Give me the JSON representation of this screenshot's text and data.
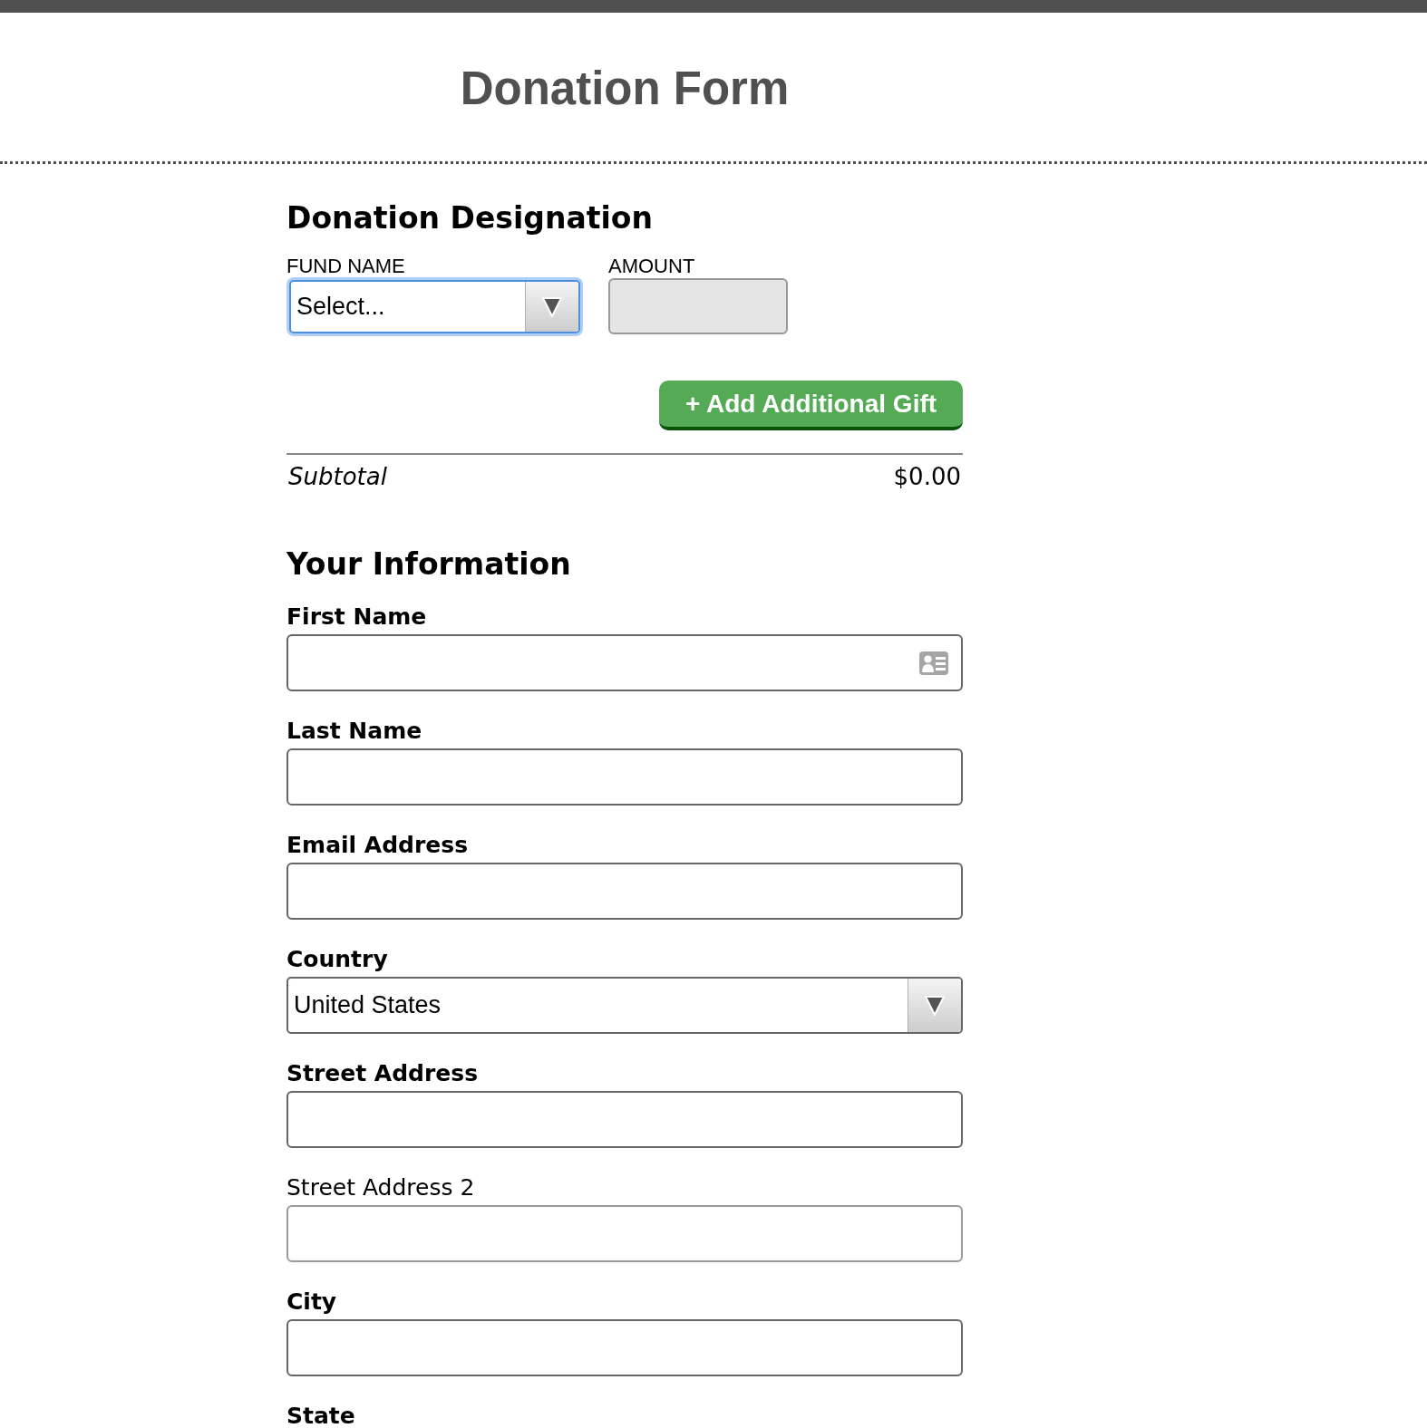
{
  "header": {
    "title": "Donation Form"
  },
  "designation": {
    "heading": "Donation Designation",
    "gift": {
      "fund_label": "FUND NAME",
      "fund_value": "Select...",
      "fund_focused": true,
      "amount_label": "AMOUNT",
      "amount_disabled": true
    },
    "add_button": "+ Add Additional Gift",
    "subtotal": {
      "label": "Subtotal",
      "value": "$0.00"
    }
  },
  "information": {
    "heading": "Your Information",
    "fields": [
      {
        "kind": "text",
        "label": "First Name",
        "required": true,
        "autofill_icon": true
      },
      {
        "kind": "text",
        "label": "Last Name",
        "required": true,
        "autofill_icon": false
      },
      {
        "kind": "text",
        "label": "Email Address",
        "required": true,
        "autofill_icon": false
      },
      {
        "kind": "select",
        "label": "Country",
        "value": "United States",
        "required": true
      },
      {
        "kind": "text",
        "label": "Street Address",
        "required": true,
        "autofill_icon": false
      },
      {
        "kind": "text",
        "label": "Street Address 2",
        "required": false,
        "autofill_icon": false
      },
      {
        "kind": "text",
        "label": "City",
        "required": true,
        "autofill_icon": false
      },
      {
        "kind": "label",
        "label": "State",
        "required": true
      }
    ]
  }
}
